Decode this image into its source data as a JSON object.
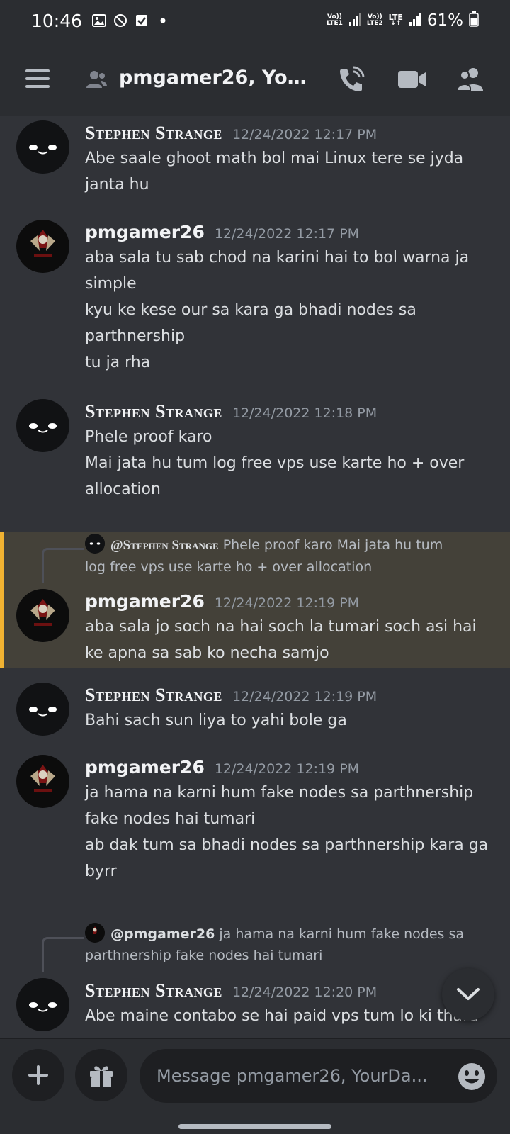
{
  "status_bar": {
    "time": "10:46",
    "sim1_label_top": "Vo))",
    "sim1_label_bottom": "LTE1",
    "sim2_label_top": "Vo))",
    "sim2_label_bottom": "LTE2",
    "net_type": "LTE",
    "battery": "61%"
  },
  "header": {
    "title": "pmgamer26, YourD..",
    "icons": [
      "menu-icon",
      "group-dm-icon",
      "call-icon",
      "video-icon",
      "members-icon"
    ]
  },
  "messages": [
    {
      "author": "Stephen Strange",
      "timestamp": "12/24/2022 12:17 PM",
      "lines": [
        "Abe saale ghoot math bol mai Linux tere se jyda",
        "janta hu"
      ]
    },
    {
      "author": "pmgamer26",
      "timestamp": "12/24/2022 12:17 PM",
      "lines": [
        "aba sala tu sab chod na karini hai to bol warna ja",
        "simple",
        "kyu ke kese our sa kara ga bhadi nodes sa",
        "parthnership",
        "tu ja rha"
      ]
    },
    {
      "author": "Stephen Strange",
      "timestamp": "12/24/2022 12:18 PM",
      "lines": [
        "Phele proof karo",
        "Mai jata hu tum log free vps use karte ho + over",
        "allocation"
      ]
    },
    {
      "author": "pmgamer26",
      "timestamp": "12/24/2022 12:19 PM",
      "reply": {
        "author": "@Stephen Strange",
        "text_line1": "Phele proof karo  Mai jata hu tum",
        "text_line2": "log free vps use karte ho + over allocation"
      },
      "lines": [
        "aba sala jo soch na hai soch la tumari soch asi hai",
        "ke apna sa sab ko necha samjo"
      ]
    },
    {
      "author": "Stephen Strange",
      "timestamp": "12/24/2022 12:19 PM",
      "lines": [
        "Bahi sach sun liya to yahi bole ga"
      ]
    },
    {
      "author": "pmgamer26",
      "timestamp": "12/24/2022 12:19 PM",
      "lines": [
        "ja hama na karni hum fake nodes sa parthnership",
        "fake nodes hai tumari",
        "ab dak tum sa bhadi nodes sa parthnership kara ga",
        "byrr"
      ]
    },
    {
      "author": "Stephen Strange",
      "timestamp": "12/24/2022 12:20 PM",
      "reply": {
        "author": "@pmgamer26",
        "text_line1": "ja hama na karni hum fake nodes sa",
        "text_line2": "parthnership fake nodes hai tumari"
      },
      "lines": [
        "Abe maine contabo se hai paid vps tum lo ki thara"
      ]
    }
  ],
  "composer": {
    "placeholder": "Message pmgamer26, YourDa...",
    "icons": [
      "plus-icon",
      "gift-icon",
      "emoji-icon"
    ]
  },
  "colors": {
    "background": "#313338",
    "header": "#2b2d31",
    "highlight": "#444139",
    "highlight_border": "#f0b232"
  }
}
